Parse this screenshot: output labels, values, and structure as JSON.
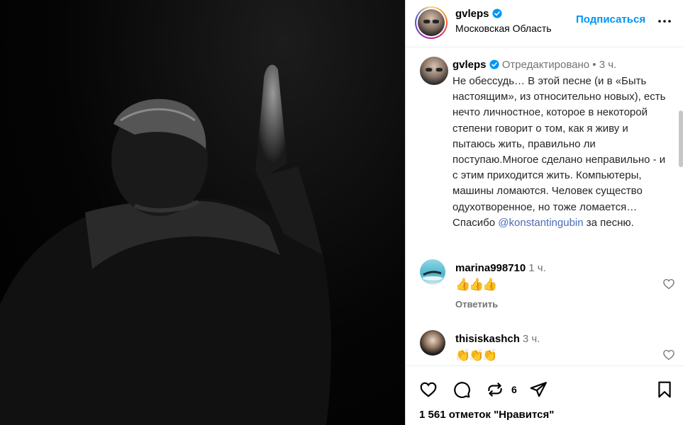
{
  "post": {
    "username": "gvleps",
    "location": "Московская Область",
    "follow_label": "Подписаться",
    "caption_status": "Отредактировано",
    "caption_separator": "•",
    "caption_time": "3 ч.",
    "caption_text": "Не обессудь… В этой песне (и в «Быть настоящим», из относительно новых), есть нечто личностное, которое в некоторой степени говорит о том, как я живу и пытаюсь жить, правильно ли поступаю.Многое сделано неправильно - и с этим приходится жить. Компьютеры, машины ломаются. Человек существо одухотворенное, но тоже ломается… Спасибо",
    "caption_mention": "@konstantingubin",
    "caption_suffix": "за песню."
  },
  "comments": [
    {
      "username": "marina998710",
      "time": "1 ч.",
      "text": "👍👍👍",
      "reply_label": "Ответить",
      "avatar": "sea-photo"
    },
    {
      "username": "thisiskashch",
      "time": "3 ч.",
      "text": "👏👏👏",
      "avatar": "portrait-photo"
    }
  ],
  "actions": {
    "repost_count": "6",
    "likes_text": "1 561 отметок \"Нравится\""
  },
  "icons": {
    "verified": "verified-badge-icon",
    "more": "more-options-icon",
    "like": "heart-icon",
    "comment": "comment-icon",
    "repost": "repost-icon",
    "share": "send-icon",
    "save": "bookmark-icon"
  },
  "colors": {
    "accent": "#0095f6",
    "secondary_text": "#737373",
    "mention": "#4b6cb7"
  }
}
